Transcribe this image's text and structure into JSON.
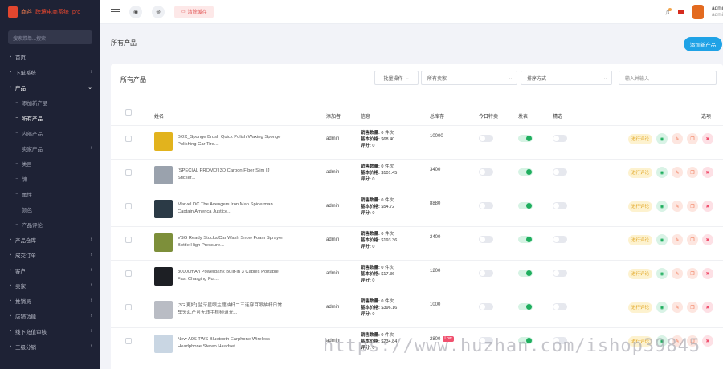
{
  "sidebar": {
    "logo_text_1": "商谷",
    "logo_text_2": "跨境电商系统",
    "logo_text_3": "pro",
    "search_placeholder": "搜索菜单...搜索",
    "items": [
      {
        "label": "首页",
        "type": "top",
        "expandable": false
      },
      {
        "label": "下单系统",
        "type": "top",
        "expandable": true
      },
      {
        "label": "产品",
        "type": "top",
        "expandable": true,
        "open": true
      },
      {
        "label": "添加新产品",
        "type": "sub"
      },
      {
        "label": "所有产品",
        "type": "sub",
        "active": true
      },
      {
        "label": "内部产品",
        "type": "sub"
      },
      {
        "label": "卖家产品",
        "type": "sub",
        "expandable": true
      },
      {
        "label": "类目",
        "type": "sub"
      },
      {
        "label": "牌",
        "type": "sub"
      },
      {
        "label": "属性",
        "type": "sub"
      },
      {
        "label": "颜色",
        "type": "sub"
      },
      {
        "label": "产品评论",
        "type": "sub"
      },
      {
        "label": "产品仓库",
        "type": "top",
        "expandable": true
      },
      {
        "label": "成交订单",
        "type": "top",
        "expandable": true
      },
      {
        "label": "客户",
        "type": "top",
        "expandable": true
      },
      {
        "label": "卖家",
        "type": "top",
        "expandable": true
      },
      {
        "label": "推销员",
        "type": "top",
        "expandable": true
      },
      {
        "label": "店铺功能",
        "type": "top",
        "expandable": true
      },
      {
        "label": "线下充值审核",
        "type": "top",
        "expandable": true
      },
      {
        "label": "三级分销",
        "type": "top",
        "expandable": true
      }
    ]
  },
  "header": {
    "pill_label": "清除缓存",
    "user_name": "admi",
    "user_role": "admi"
  },
  "page": {
    "title": "所有产品",
    "add_button": "添加新产品"
  },
  "card": {
    "title": "所有产品",
    "bulk_action": "批量操作",
    "seller_filter": "所有卖家",
    "sort_filter": "排序方式",
    "search_placeholder": "输入并输入"
  },
  "table": {
    "headers": {
      "name": "姓名",
      "added_by": "添加者",
      "info": "信息",
      "total_stock": "总库存",
      "todays_deal": "今日特卖",
      "published": "发表",
      "featured": "精选",
      "options": "选项"
    },
    "info_labels": {
      "sales": "销售数量:",
      "base_price": "基本价格:",
      "rating": "评分:"
    },
    "action_label": "进行评论",
    "rows": [
      {
        "name": "BOX_Sponge Brush Quick Polish Waxing Sponge Polishing Car Tire...",
        "added_by": "admin",
        "sales": "0 件次",
        "price": "$68.40",
        "rating": "0",
        "stock": "10000",
        "low": "",
        "deal": false,
        "published": true,
        "featured": false,
        "thumb": "#e2b31d"
      },
      {
        "name": "[SPECIAL PROMO] 3D Carbon Fiber Slim IJ Sticker...",
        "added_by": "admin",
        "sales": "0 件次",
        "price": "$101.45",
        "rating": "0",
        "stock": "3400",
        "low": "",
        "deal": false,
        "published": true,
        "featured": false,
        "thumb": "#9aa2ad"
      },
      {
        "name": "Marvel DC The Avengers Iron Man Spiderman Captain America Justice...",
        "added_by": "admin",
        "sales": "0 件次",
        "price": "$54.72",
        "rating": "0",
        "stock": "8880",
        "low": "",
        "deal": false,
        "published": true,
        "featured": false,
        "thumb": "#2b3a46"
      },
      {
        "name": "VSG Ready Stocks/Car Wash Snow Foam Sprayer Bottle High Pressure...",
        "added_by": "admin",
        "sales": "0 件次",
        "price": "$193.36",
        "rating": "0",
        "stock": "2400",
        "low": "",
        "deal": false,
        "published": true,
        "featured": false,
        "thumb": "#7d8f3a"
      },
      {
        "name": "30000mAh Powerbank Built-in 3 Cables Portable Fast Charging Ful...",
        "added_by": "admin",
        "sales": "0 件次",
        "price": "$17.36",
        "rating": "0",
        "stock": "1200",
        "low": "",
        "deal": false,
        "published": true,
        "featured": false,
        "thumb": "#1d1f24"
      },
      {
        "name": "[3G 更好] 监牙星眼主题抽杆二三连穿耳眼抽杆日常车头汇产可无线手机频道光...",
        "added_by": "admin",
        "sales": "0 件次",
        "price": "$396.16",
        "rating": "0",
        "stock": "1000",
        "low": "",
        "deal": false,
        "published": true,
        "featured": false,
        "thumb": "#b9bcc4"
      },
      {
        "name": "New A9S TWS Bluetooth Earphone Wireless Headphone Stereo Headset...",
        "added_by": "admin",
        "sales": "0 件次",
        "price": "$234.84",
        "rating": "0",
        "stock": "2800",
        "low": "Low",
        "deal": false,
        "published": true,
        "featured": false,
        "thumb": "#c9d6e3"
      }
    ]
  },
  "watermark": "https://www.huzhan.com/ishop39845"
}
